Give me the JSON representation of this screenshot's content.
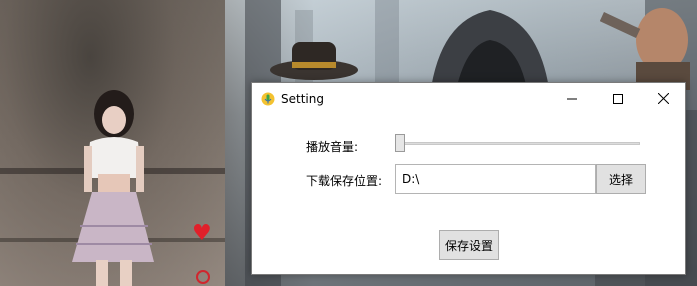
{
  "window": {
    "title": "Setting",
    "icon": "microphone-icon"
  },
  "settings": {
    "volume_label": "播放音量:",
    "volume_value": 0,
    "path_label": "下载保存位置:",
    "path_value": "D:\\",
    "choose_label": "选择",
    "save_label": "保存设置"
  },
  "colors": {
    "close_hover": "#e81123",
    "button_bg": "#e1e1e1",
    "heart": "#e0202a"
  }
}
